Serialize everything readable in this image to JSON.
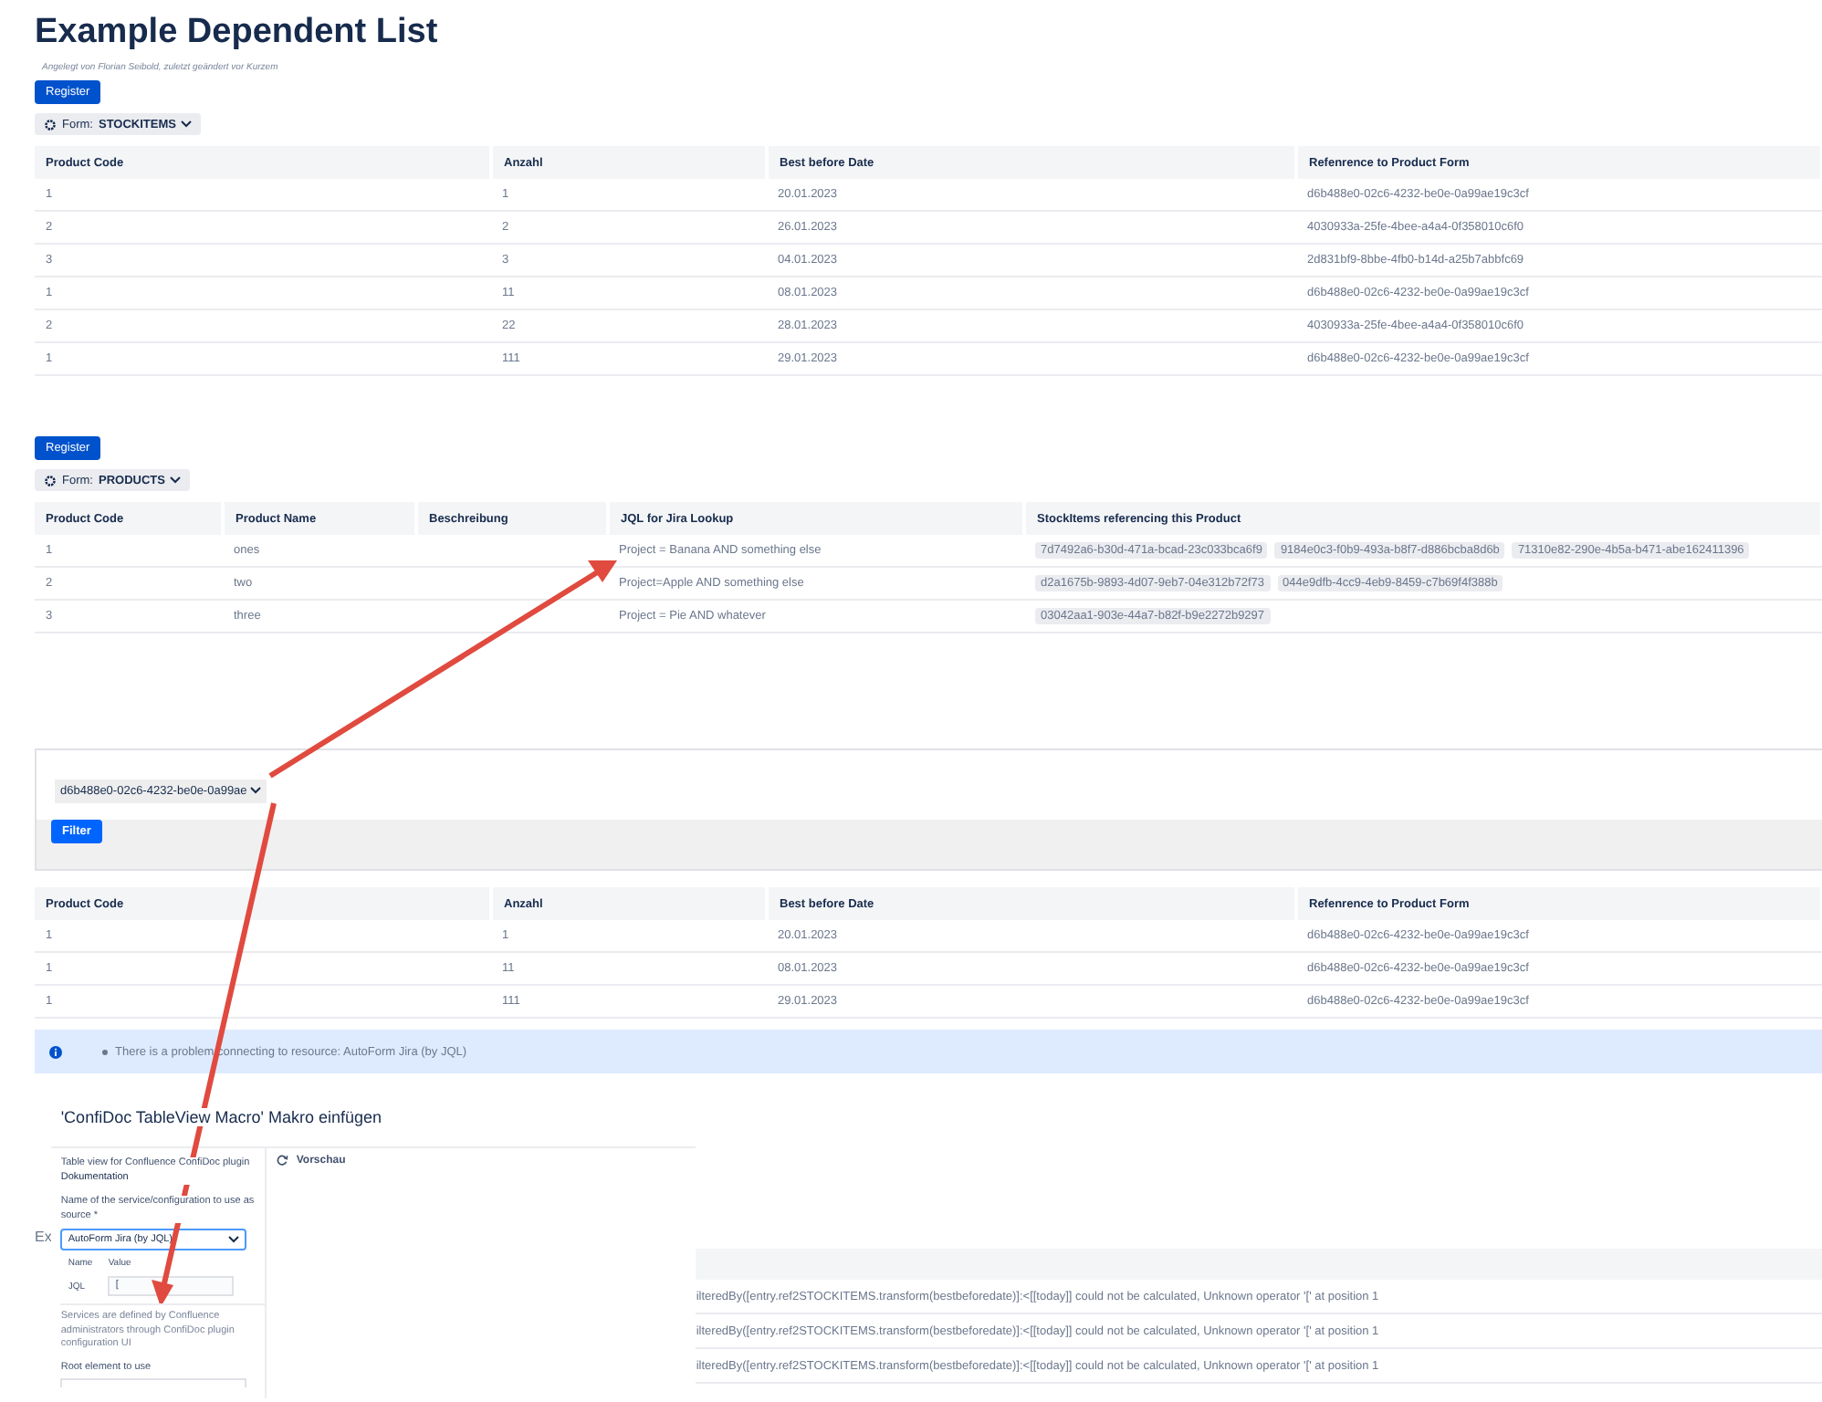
{
  "page": {
    "title": "Example Dependent List",
    "byline": "Angelegt von Florian Seibold, zuletzt geändert vor Kurzem"
  },
  "sections": [
    {
      "register_button": "Register",
      "form_menu": {
        "label": "Form:",
        "name": "STOCKITEMS"
      },
      "table": {
        "columns": [
          "Product Code",
          "Anzahl",
          "Best before Date",
          "Refenrence to Product Form"
        ],
        "rows": [
          [
            "1",
            "1",
            "20.01.2023",
            "d6b488e0-02c6-4232-be0e-0a99ae19c3cf"
          ],
          [
            "2",
            "2",
            "26.01.2023",
            "4030933a-25fe-4bee-a4a4-0f358010c6f0"
          ],
          [
            "3",
            "3",
            "04.01.2023",
            "2d831bf9-8bbe-4fb0-b14d-a25b7abbfc69"
          ],
          [
            "1",
            "11",
            "08.01.2023",
            "d6b488e0-02c6-4232-be0e-0a99ae19c3cf"
          ],
          [
            "2",
            "22",
            "28.01.2023",
            "4030933a-25fe-4bee-a4a4-0f358010c6f0"
          ],
          [
            "1",
            "111",
            "29.01.2023",
            "d6b488e0-02c6-4232-be0e-0a99ae19c3cf"
          ]
        ]
      }
    },
    {
      "register_button": "Register",
      "form_menu": {
        "label": "Form:",
        "name": "PRODUCTS"
      },
      "table": {
        "columns": [
          "Product Code",
          "Product Name",
          "Beschreibung",
          "JQL for Jira Lookup",
          "StockItems referencing this Product"
        ],
        "rows": [
          [
            "1",
            "ones",
            "",
            "Project = Banana AND something else",
            [
              "7d7492a6-b30d-471a-bcad-23c033bca6f9",
              "9184e0c3-f0b9-493a-b8f7-d886bcba8d6b",
              "71310e82-290e-4b5a-b471-abe162411396"
            ]
          ],
          [
            "2",
            "two",
            "",
            "Project=Apple AND something else",
            [
              "d2a1675b-9893-4d07-9eb7-04e312b72f73",
              "044e9dfb-4cc9-4eb9-8459-c7b69f4f388b"
            ]
          ],
          [
            "3",
            "three",
            "",
            "Project = Pie AND whatever",
            [
              "03042aa1-903e-44a7-b82f-b9e2272b9297"
            ]
          ]
        ]
      }
    }
  ],
  "filter": {
    "select_value": "d6b488e0-02c6-4232-be0e-0a99ae",
    "button": "Filter"
  },
  "filtered_table": {
    "columns": [
      "Product Code",
      "Anzahl",
      "Best before Date",
      "Refenrence to Product Form"
    ],
    "rows": [
      [
        "1",
        "1",
        "20.01.2023",
        "d6b488e0-02c6-4232-be0e-0a99ae19c3cf"
      ],
      [
        "1",
        "11",
        "08.01.2023",
        "d6b488e0-02c6-4232-be0e-0a99ae19c3cf"
      ],
      [
        "1",
        "111",
        "29.01.2023",
        "d6b488e0-02c6-4232-be0e-0a99ae19c3cf"
      ]
    ]
  },
  "notice": {
    "items": [
      "There is a problem connecting to resource: AutoForm Jira (by JQL)"
    ]
  },
  "background": {
    "heading": "Ex",
    "rows": [
      "ilteredBy([entry.ref2STOCKITEMS.transform(bestbeforedate)]:<[[today]] could not be calculated, Unknown operator '[' at position 1",
      "ilteredBy([entry.ref2STOCKITEMS.transform(bestbeforedate)]:<[[today]] could not be calculated, Unknown operator '[' at position 1",
      "ilteredBy([entry.ref2STOCKITEMS.transform(bestbeforedate)]:<[[today]] could not be calculated, Unknown operator '[' at position 1"
    ]
  },
  "dialog": {
    "title": "'ConfiDoc TableView Macro' Makro einfügen",
    "description": "Table view for Confluence ConfiDoc plugin",
    "doc_link": "Dokumentation",
    "service_label": "Name of the service/configuration to use as source *",
    "service_select": "AutoForm Jira (by JQL)",
    "param_columns": [
      "Name",
      "Value"
    ],
    "params": [
      {
        "name": "JQL",
        "value": "["
      }
    ],
    "help": "Services are defined by Confluence administrators through ConfiDoc plugin configuration UI",
    "root_label": "Root element to use",
    "preview_button": "Vorschau"
  }
}
